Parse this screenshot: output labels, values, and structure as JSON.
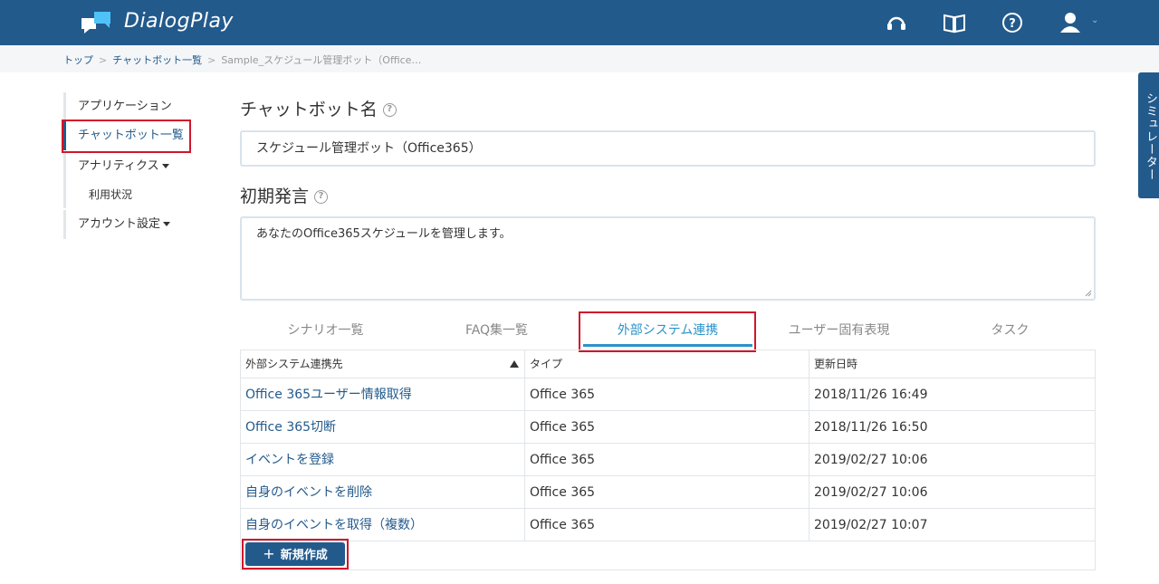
{
  "app": {
    "name": "DialogPlay"
  },
  "breadcrumb": {
    "items": [
      "トップ",
      "チャットボット一覧"
    ],
    "current": "Sample_スケジュール管理ボット（Office…"
  },
  "sidebar": {
    "items": [
      {
        "label": "アプリケーション"
      },
      {
        "label": "チャットボット一覧"
      },
      {
        "label": "アナリティクス"
      },
      {
        "label": "利用状況"
      },
      {
        "label": "アカウント設定"
      }
    ]
  },
  "form": {
    "name_label": "チャットボット名",
    "name_value": "スケジュール管理ボット（Office365）",
    "greeting_label": "初期発言",
    "greeting_value": "あなたのOffice365スケジュールを管理します。",
    "help_glyph": "?"
  },
  "tabs": [
    {
      "label": "シナリオ一覧"
    },
    {
      "label": "FAQ集一覧"
    },
    {
      "label": "外部システム連携"
    },
    {
      "label": "ユーザー固有表現"
    },
    {
      "label": "タスク"
    }
  ],
  "table": {
    "columns": [
      "外部システム連携先",
      "タイプ",
      "更新日時"
    ],
    "rows": [
      {
        "name": "Office 365ユーザー情報取得",
        "type": "Office 365",
        "updated": "2018/11/26 16:49"
      },
      {
        "name": "Office 365切断",
        "type": "Office 365",
        "updated": "2018/11/26 16:50"
      },
      {
        "name": "イベントを登録",
        "type": "Office 365",
        "updated": "2019/02/27 10:06"
      },
      {
        "name": "自身のイベントを削除",
        "type": "Office 365",
        "updated": "2019/02/27 10:06"
      },
      {
        "name": "自身のイベントを取得（複数）",
        "type": "Office 365",
        "updated": "2019/02/27 10:07"
      }
    ]
  },
  "new_button": {
    "icon": "+",
    "label": "新規作成"
  },
  "simulator": {
    "label": "シミュレーター"
  },
  "colors": {
    "primary": "#235a8c",
    "accent_tab": "#2a93c9",
    "highlight": "#d0162b"
  },
  "icons": [
    "headset-icon",
    "book-icon",
    "help-icon",
    "user-icon"
  ]
}
